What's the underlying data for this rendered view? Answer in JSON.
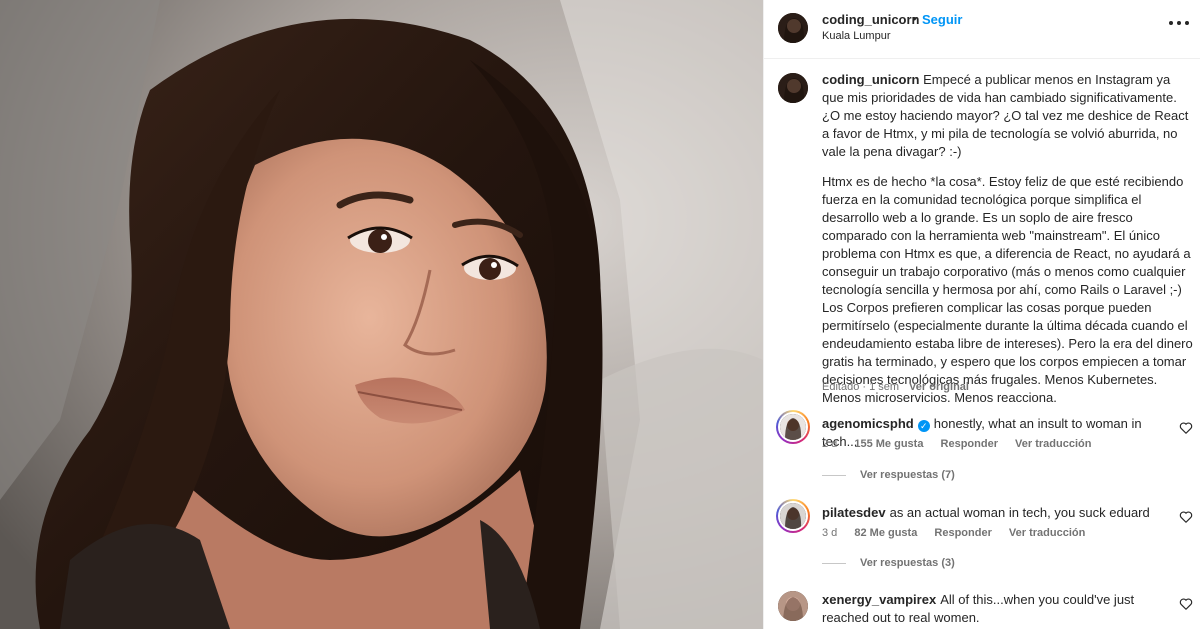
{
  "post": {
    "author": "coding_unicorn",
    "follow_label": "Seguir",
    "dot": "•",
    "location": "Kuala Lumpur",
    "caption_p1": "Empecé a publicar menos en Instagram ya que mis prioridades de vida han cambiado significativamente. ¿O me estoy haciendo mayor? ¿O tal vez me deshice de React a favor de Htmx, y mi pila de tecnología se volvió aburrida, no vale la pena divagar? :-)",
    "caption_p2": "Htmx es de hecho *la cosa*. Estoy feliz de que esté recibiendo fuerza en la comunidad tecnológica porque simplifica el desarrollo web a lo grande. Es un soplo de aire fresco comparado con la herramienta web \"mainstream\". El único problema con Htmx es que, a diferencia de React, no ayudará a conseguir un trabajo corporativo (más o menos como cualquier tecnología sencilla y hermosa por ahí, como Rails o Laravel ;-) Los Corpos prefieren complicar las cosas porque pueden permitírselo (especialmente durante la última década cuando el endeudamiento estaba libre de intereses). Pero la era del dinero gratis ha terminado, y espero que los corpos empiecen a tomar decisiones tecnológicas más frugales. Menos Kubernetes. Menos microservicios. Menos reacciona.",
    "edited_label": "Editado · 1 sem",
    "view_original_label": "Ver original"
  },
  "comments": [
    {
      "user": "agenomicsphd",
      "verified": true,
      "text": "honestly, what an insult to woman in tech...",
      "time": "2 d",
      "likes": "155 Me gusta",
      "reply_label": "Responder",
      "translate_label": "Ver traducción",
      "replies_label": "Ver respuestas (7)"
    },
    {
      "user": "pilatesdev",
      "verified": false,
      "text": "as an actual woman in tech, you suck eduard",
      "time": "3 d",
      "likes": "82 Me gusta",
      "reply_label": "Responder",
      "translate_label": "Ver traducción",
      "replies_label": "Ver respuestas (3)"
    },
    {
      "user": "xenergy_vampirex",
      "verified": false,
      "text": "All of this...when you could've just reached out to real women."
    }
  ],
  "icons": {
    "more": "more-options-icon",
    "heart": "heart-outline-icon",
    "verified": "verified-badge-icon",
    "verified_glyph": "✓"
  },
  "colors": {
    "accent": "#0095f6",
    "muted": "#737373",
    "text": "#262626"
  }
}
